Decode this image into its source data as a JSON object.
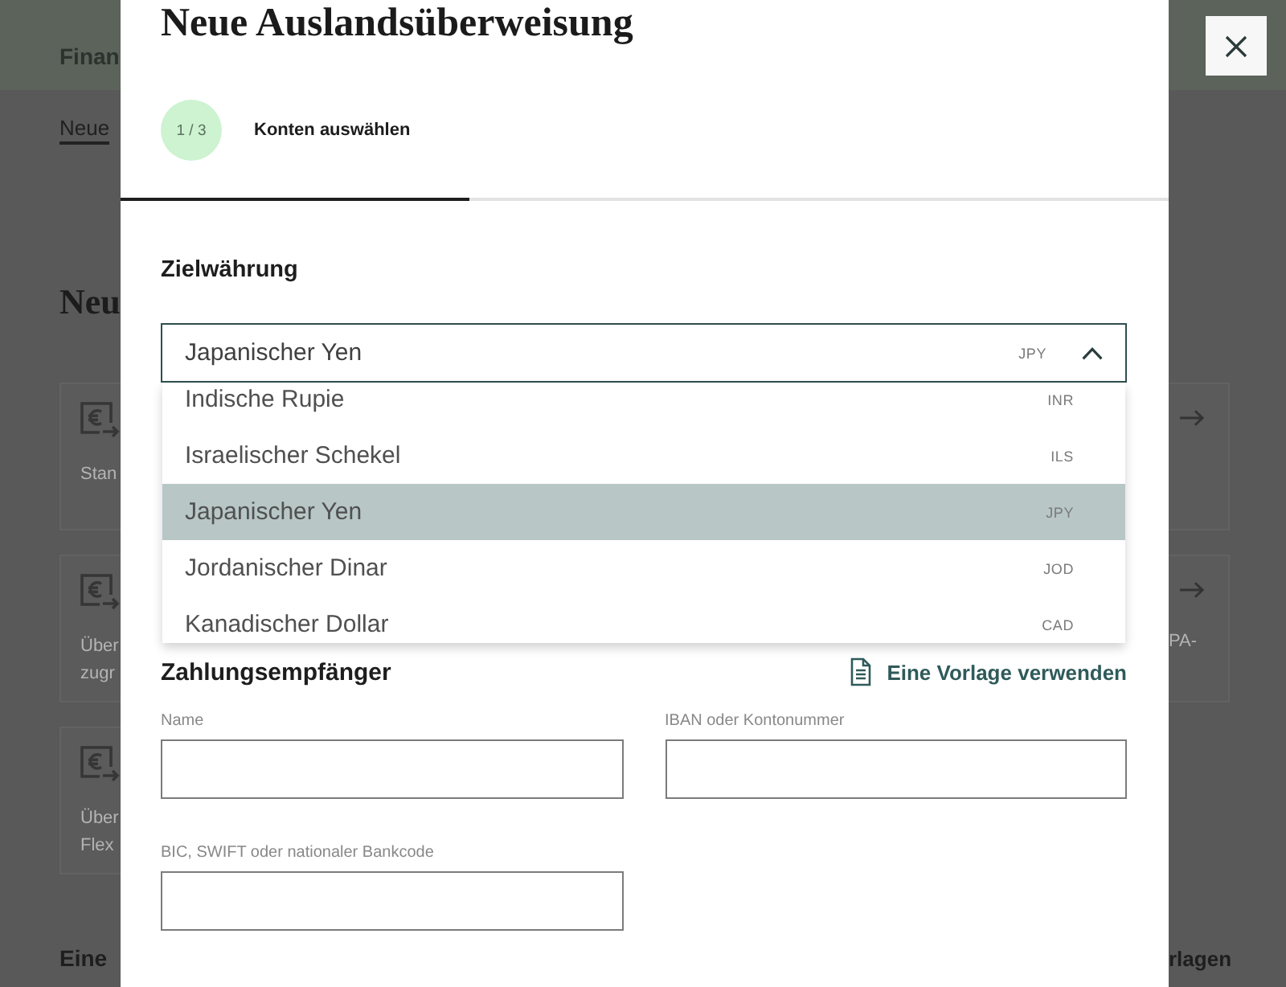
{
  "background_page": {
    "header_title": "Finan",
    "breadcrumb_link": "Neue",
    "heading": "Neu",
    "left_cards": [
      {
        "kind": "transfer",
        "lines": [
          "Stan"
        ]
      },
      {
        "kind": "transfer",
        "lines": [
          "Über",
          "zugr"
        ]
      },
      {
        "kind": "transfer",
        "lines": [
          "Über",
          "Flex"
        ]
      }
    ],
    "left_footer": "Eine",
    "right_cards": [
      {
        "kind": "link"
      },
      {
        "kind": "link",
        "lines": [
          "PA-"
        ]
      }
    ],
    "right_footer": "rlagen"
  },
  "dialog": {
    "title": "Neue Auslandsüberweisung",
    "step": {
      "counter": "1 / 3",
      "label": "Konten auswählen",
      "level": 0.333
    },
    "target_currency": {
      "label": "Zielwährung",
      "value": "Japanischer Yen",
      "code": "JPY",
      "expanded": true,
      "options": [
        {
          "name": "Indische Rupie",
          "code": "INR",
          "selected": false
        },
        {
          "name": "Israelischer Schekel",
          "code": "ILS",
          "selected": false
        },
        {
          "name": "Japanischer Yen",
          "code": "JPY",
          "selected": true
        },
        {
          "name": "Jordanischer Dinar",
          "code": "JOD",
          "selected": false
        },
        {
          "name": "Kanadischer Dollar",
          "code": "CAD",
          "selected": false
        }
      ]
    },
    "payee": {
      "heading": "Zahlungsempfänger",
      "template_link": "Eine Vorlage verwenden",
      "fields": [
        {
          "label": "Name"
        },
        {
          "label": "IBAN oder Kontonummer"
        },
        {
          "label": "BIC, SWIFT oder nationaler Bankcode"
        }
      ]
    }
  }
}
